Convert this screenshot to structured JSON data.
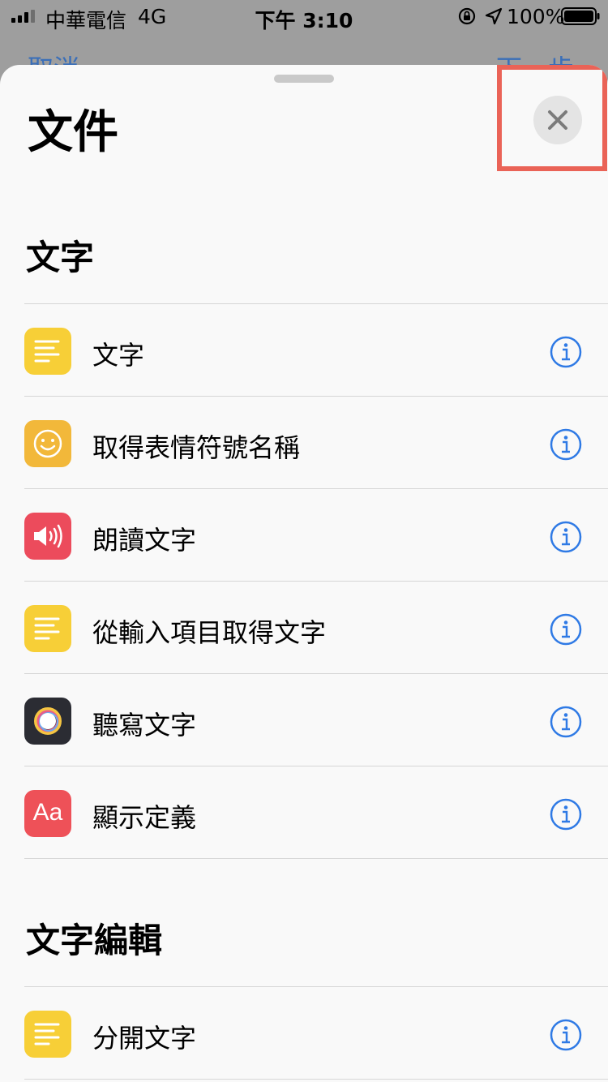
{
  "status_bar": {
    "carrier": "中華電信",
    "network": "4G",
    "time": "下午 3:10",
    "battery": "100%"
  },
  "background_nav": {
    "left": "取消",
    "right": "下一步"
  },
  "sheet": {
    "title": "文件",
    "close_icon": "close-icon"
  },
  "sections": [
    {
      "title": "文字",
      "items": [
        {
          "label": "文字",
          "icon": "text-lines-icon",
          "color": "#f7cf37"
        },
        {
          "label": "取得表情符號名稱",
          "icon": "smiley-icon",
          "color": "#f2b83a"
        },
        {
          "label": "朗讀文字",
          "icon": "speaker-icon",
          "color": "#ec4b5c"
        },
        {
          "label": "從輸入項目取得文字",
          "icon": "text-lines-icon",
          "color": "#f7cf37"
        },
        {
          "label": "聽寫文字",
          "icon": "dictation-icon",
          "color": "#2b2c33"
        },
        {
          "label": "顯示定義",
          "icon": "dictionary-icon",
          "icon_text": "Aa",
          "color": "#ee5158"
        }
      ]
    },
    {
      "title": "文字編輯",
      "items": [
        {
          "label": "分開文字",
          "icon": "text-lines-icon",
          "color": "#f7cf37"
        }
      ]
    }
  ],
  "colors": {
    "accent": "#2f7ae5",
    "highlight": "#ea6357"
  }
}
